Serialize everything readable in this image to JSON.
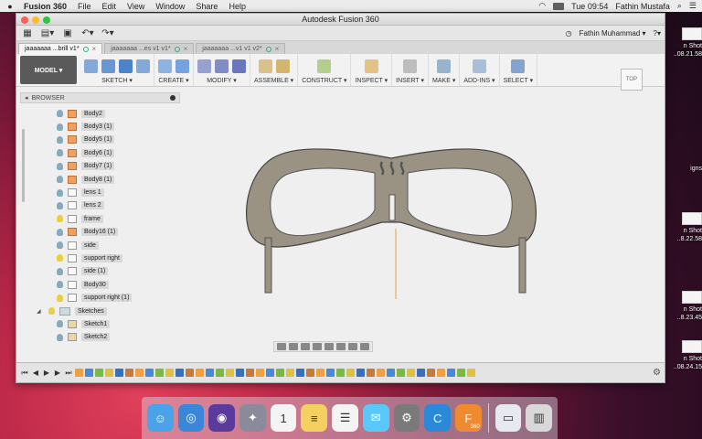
{
  "menubar": {
    "app": "Fusion 360",
    "items": [
      "File",
      "Edit",
      "View",
      "Window",
      "Share",
      "Help"
    ],
    "battery": "",
    "clock": "Tue 09:54",
    "user": "Fathin Mustafa"
  },
  "window": {
    "title": "Autodesk Fusion 360",
    "account": "Fathin Muhammad ▾",
    "help": "?▾",
    "tabs": [
      {
        "label": "jaaaaaaa ...brill v1*",
        "active": true
      },
      {
        "label": "jaaaaaaa ...es v1 v1*",
        "active": false
      },
      {
        "label": "jaaaaaaa ...v1 v1 v2*",
        "active": false
      }
    ]
  },
  "ribbon": {
    "model": "MODEL ▾",
    "groups": [
      {
        "label": "SKETCH ▾",
        "icons": [
          "sketch-icon",
          "arc-icon",
          "rectangle-icon",
          "line-icon"
        ]
      },
      {
        "label": "CREATE ▾",
        "icons": [
          "box-icon",
          "form-icon"
        ]
      },
      {
        "label": "MODIFY ▾",
        "icons": [
          "press-pull-icon",
          "fillet-icon",
          "chamfer-icon"
        ]
      },
      {
        "label": "ASSEMBLE ▾",
        "icons": [
          "joint-icon",
          "rigid-icon"
        ]
      },
      {
        "label": "CONSTRUCT ▾",
        "icons": [
          "plane-icon"
        ]
      },
      {
        "label": "INSPECT ▾",
        "icons": [
          "measure-icon"
        ]
      },
      {
        "label": "INSERT ▾",
        "icons": [
          "image-icon"
        ]
      },
      {
        "label": "MAKE ▾",
        "icons": [
          "print-icon"
        ]
      },
      {
        "label": "ADD-INS ▾",
        "icons": [
          "addins-icon"
        ]
      },
      {
        "label": "SELECT ▾",
        "icons": [
          "select-icon"
        ]
      }
    ]
  },
  "viewcube": "TOP",
  "browser": {
    "title": "BROWSER",
    "items": [
      {
        "label": "Body2",
        "type": "body",
        "eye": "off"
      },
      {
        "label": "Body3 (1)",
        "type": "body",
        "eye": "off"
      },
      {
        "label": "Body5 (1)",
        "type": "body",
        "eye": "off"
      },
      {
        "label": "Body6 (1)",
        "type": "body",
        "eye": "off"
      },
      {
        "label": "Body7 (1)",
        "type": "body",
        "eye": "off"
      },
      {
        "label": "Body8 (1)",
        "type": "body",
        "eye": "off"
      },
      {
        "label": "lens 1",
        "type": "plain",
        "eye": "off"
      },
      {
        "label": "lens 2",
        "type": "plain",
        "eye": "off"
      },
      {
        "label": "frame",
        "type": "plain",
        "eye": "on"
      },
      {
        "label": "Body16 (1)",
        "type": "body",
        "eye": "off"
      },
      {
        "label": "side",
        "type": "plain",
        "eye": "off"
      },
      {
        "label": "support right",
        "type": "plain",
        "eye": "on"
      },
      {
        "label": "side (1)",
        "type": "plain",
        "eye": "off"
      },
      {
        "label": "Body30",
        "type": "plain",
        "eye": "off"
      },
      {
        "label": "support right (1)",
        "type": "plain",
        "eye": "on"
      }
    ],
    "folder": "Sketches",
    "sketches": [
      "Sketch1",
      "Sketch2"
    ]
  },
  "timeline_count": 40,
  "desktop_files": [
    {
      "line1": "n Shot",
      "line2": "..08.21.58"
    },
    {
      "line1": "",
      "line2": "igns"
    },
    {
      "line1": "n Shot",
      "line2": "..8.22.58"
    },
    {
      "line1": "n Shot",
      "line2": "..8.23.45"
    },
    {
      "line1": "n Shot",
      "line2": "..08.24.15"
    }
  ],
  "dock": [
    {
      "name": "finder-icon",
      "color": "#4aa3e8",
      "glyph": "☺"
    },
    {
      "name": "safari-icon",
      "color": "#3a86d8",
      "glyph": "◎"
    },
    {
      "name": "siri-icon",
      "color": "#5a3a9a",
      "glyph": "◉"
    },
    {
      "name": "launchpad-icon",
      "color": "#8a8a9a",
      "glyph": "✦"
    },
    {
      "name": "calendar-icon",
      "color": "#f4f4f4",
      "glyph": "1"
    },
    {
      "name": "notes-icon",
      "color": "#f4d060",
      "glyph": "≡"
    },
    {
      "name": "reminders-icon",
      "color": "#f4f4f4",
      "glyph": "☰"
    },
    {
      "name": "messages-icon",
      "color": "#5ac8fa",
      "glyph": "✉"
    },
    {
      "name": "system-preferences-icon",
      "color": "#7a7a7a",
      "glyph": "⚙"
    },
    {
      "name": "cc-icon",
      "color": "#2a8ad8",
      "glyph": "C"
    },
    {
      "name": "fusion360-icon",
      "color": "#f08a30",
      "glyph": "F"
    },
    {
      "name": "documents-icon",
      "color": "#e8e8f0",
      "glyph": "▭"
    },
    {
      "name": "trash-icon",
      "color": "#d8d8d8",
      "glyph": "▥"
    }
  ],
  "dock_fusion_sub": "360"
}
